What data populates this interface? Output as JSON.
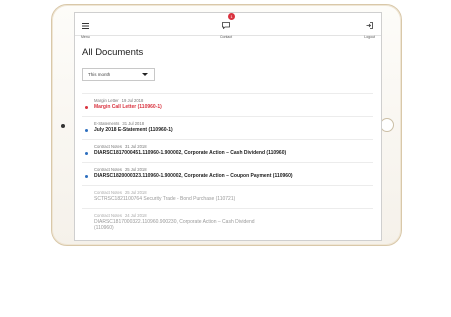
{
  "topbar": {
    "menu_label": "Menu",
    "contact_label": "Contact",
    "contact_badge": "1",
    "logout_label": "Logout"
  },
  "page": {
    "title": "All Documents",
    "filter_value": "This month"
  },
  "documents": [
    {
      "category": "Margin Letter",
      "date": "19 Jul 2018",
      "title": "Margin Call Letter (110960-1)",
      "state": "unread",
      "accent": "#d9333f"
    },
    {
      "category": "E-Statements",
      "date": "31 Jul 2018",
      "title": "July 2018 E-Statement (110960-1)",
      "state": "unread",
      "accent": "#2e6fbf"
    },
    {
      "category": "Contract Notes",
      "date": "31 Jul 2018",
      "title": "DIARSC1817000451.110960-1.900002, Corporate Action – Cash Dividend (110960)",
      "state": "unread",
      "accent": "#2e6fbf"
    },
    {
      "category": "Contract Notes",
      "date": "25 Jul 2018",
      "title": "DIARSC1820000323.110960-1.900002, Corporate Action – Coupon Payment (110960)",
      "state": "unread",
      "accent": "#2e6fbf"
    },
    {
      "category": "Contract Notes",
      "date": "25 Jul 2018",
      "title": "SCTRSC1821100764 Security Trade - Bond Purchase (110721)",
      "state": "read",
      "accent": ""
    },
    {
      "category": "Contract Notes",
      "date": "24 Jul 2018",
      "title": "DIARSC1817000322.110960.900230, Corporate Action – Cash Dividend (110960)",
      "state": "read",
      "accent": ""
    }
  ]
}
